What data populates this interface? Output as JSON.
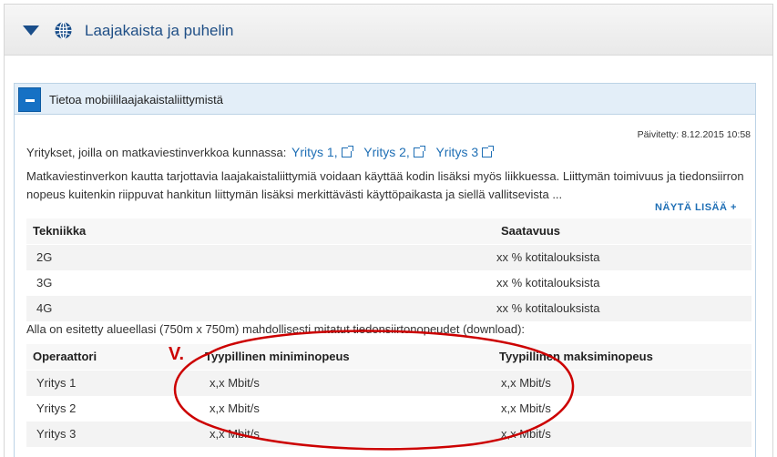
{
  "header": {
    "title": "Laajakaista ja puhelin"
  },
  "panel": {
    "title": "Tietoa mobiililaajakaistaliittymistä",
    "updated": "Päivitetty: 8.12.2015 10:58",
    "companies_label": "Yritykset, joilla on matkaviestinverkkoa kunnassa:",
    "companies": [
      "Yritys 1,",
      "Yritys 2,",
      "Yritys 3"
    ],
    "description": "Matkaviestinverkon kautta tarjottavia laajakaistaliittymiä voidaan käyttää kodin lisäksi myös liikkuessa. Liittymän toimivuus ja tiedonsiirron nopeus kuitenkin riippuvat hankitun liittymän lisäksi merkittävästi käyttöpaikasta ja siellä vallitsevista ...",
    "more_label": "NÄYTÄ LISÄÄ +"
  },
  "tech_table": {
    "headers": [
      "Tekniikka",
      "Saatavuus"
    ],
    "rows": [
      [
        "2G",
        "xx % kotitalouksista"
      ],
      [
        "3G",
        "xx % kotitalouksista"
      ],
      [
        "4G",
        "xx % kotitalouksista"
      ]
    ]
  },
  "speed_note": "Alla on esitetty alueellasi (750m x 750m) mahdollisesti mitatut tiedonsiirtonopeudet (download):",
  "speed_table": {
    "headers": [
      "Operaattori",
      "Tyypillinen miniminopeus",
      "Tyypillinen maksiminopeus"
    ],
    "rows": [
      [
        "Yritys 1",
        "x,x Mbit/s",
        "x,x Mbit/s"
      ],
      [
        "Yritys 2",
        "x,x Mbit/s",
        "x,x Mbit/s"
      ],
      [
        "Yritys 3",
        "x,x Mbit/s",
        "x,x Mbit/s"
      ]
    ]
  },
  "annotation": {
    "mark": "V.",
    "color": "#cc0000"
  },
  "icons": {
    "collapse": "triangle-down-icon",
    "globe": "globe-icon",
    "minus": "minus-icon",
    "external": "external-link-icon"
  }
}
